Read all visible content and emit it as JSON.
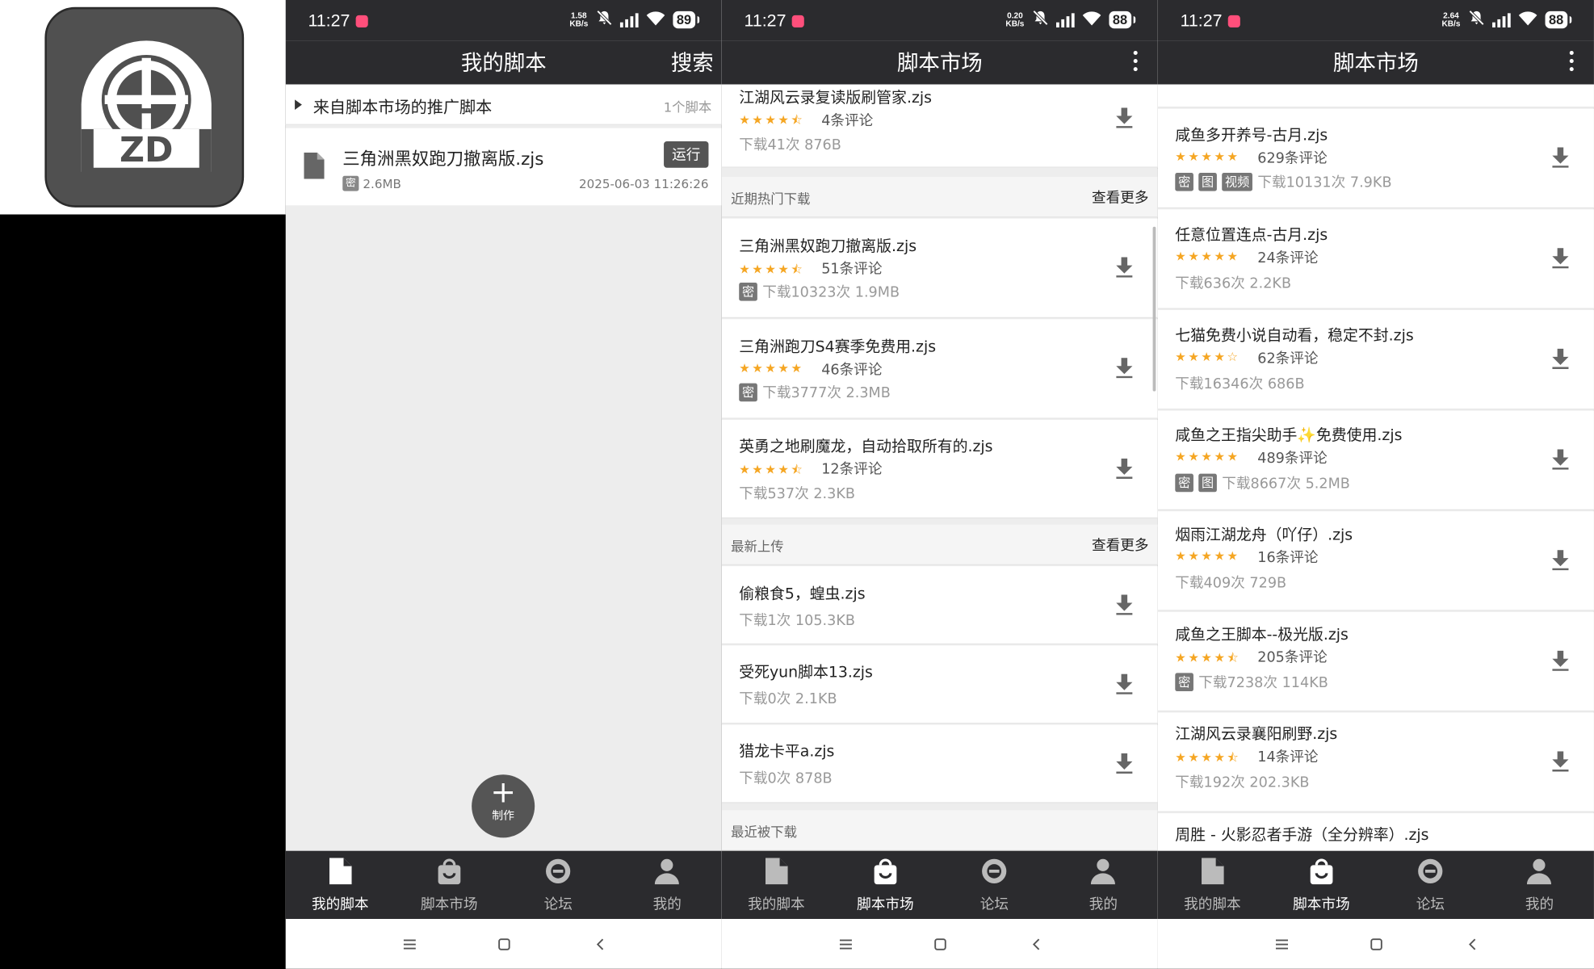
{
  "status": [
    {
      "time": "11:27",
      "net_value": "1.58",
      "net_unit": "KB/s",
      "battery": "89"
    },
    {
      "time": "11:27",
      "net_value": "0.20",
      "net_unit": "KB/s",
      "battery": "88"
    },
    {
      "time": "11:27",
      "net_value": "2.64",
      "net_unit": "KB/s",
      "battery": "88"
    }
  ],
  "app_icon": {
    "text": "ZD"
  },
  "screen1": {
    "title": "我的脚本",
    "search": "搜索",
    "promo": {
      "label": "来自脚本市场的推广脚本",
      "count": "1个脚本"
    },
    "script": {
      "name": "三角洲黑奴跑刀撤离版.zjs",
      "run": "运行",
      "tag": "密",
      "size": "2.6MB",
      "date": "2025-06-03 11:26:26"
    },
    "fab": {
      "label": "制作"
    }
  },
  "screen2": {
    "title": "脚本市场",
    "top_item": {
      "name": "江湖风云录复读版刷管家.zjs",
      "stars": "★★★★⯪",
      "reviews": "4条评论",
      "meta": "下载41次 876B"
    },
    "hot": {
      "title": "近期热门下载",
      "more": "查看更多",
      "items": [
        {
          "name": "三角洲黑奴跑刀撤离版.zjs",
          "stars": "★★★★⯪",
          "reviews": "51条评论",
          "tag": "密",
          "meta": "下载10323次 1.9MB"
        },
        {
          "name": "三角洲跑刀S4赛季免费用.zjs",
          "stars": "★★★★★",
          "reviews": "46条评论",
          "tag": "密",
          "meta": "下载3777次 2.3MB"
        },
        {
          "name": "英勇之地刷魔龙，自动拾取所有的.zjs",
          "stars": "★★★★⯪",
          "reviews": "12条评论",
          "meta": "下载537次 2.3KB"
        }
      ]
    },
    "latest": {
      "title": "最新上传",
      "more": "查看更多",
      "items": [
        {
          "name": "偷粮食5，蝗虫.zjs",
          "meta": "下载1次 105.3KB"
        },
        {
          "name": "受死yun脚本13.zjs",
          "meta": "下载0次 2.1KB"
        },
        {
          "name": "猎龙卡平a.zjs",
          "meta": "下载0次 878B"
        }
      ]
    },
    "recent": {
      "title": "最近被下载"
    }
  },
  "screen3": {
    "title": "脚本市场",
    "items": [
      {
        "name": "咸鱼多开养号-古月.zjs",
        "stars": "★★★★★",
        "reviews": "629条评论",
        "tags": [
          "密",
          "图",
          "视频"
        ],
        "meta": "下载10131次 7.9KB"
      },
      {
        "name": "任意位置连点-古月.zjs",
        "stars": "★★★★★",
        "reviews": "24条评论",
        "meta": "下载636次 2.2KB"
      },
      {
        "name": "七猫免费小说自动看，稳定不封.zjs",
        "stars": "★★★★☆",
        "reviews": "62条评论",
        "meta": "下载16346次 686B"
      },
      {
        "name": "咸鱼之王指尖助手✨免费使用.zjs",
        "stars": "★★★★★",
        "reviews": "489条评论",
        "tags": [
          "密",
          "图"
        ],
        "meta": "下载8667次 5.2MB"
      },
      {
        "name": "烟雨江湖龙舟（吖仔）.zjs",
        "stars": "★★★★★",
        "reviews": "16条评论",
        "meta": "下载409次 729B"
      },
      {
        "name": "咸鱼之王脚本--极光版.zjs",
        "stars": "★★★★⯪",
        "reviews": "205条评论",
        "tags": [
          "密"
        ],
        "meta": "下载7238次 114KB"
      },
      {
        "name": "江湖风云录襄阳刷野.zjs",
        "stars": "★★★★⯪",
        "reviews": "14条评论",
        "meta": "下载192次 202.3KB"
      },
      {
        "name": "周胜 - 火影忍者手游（全分辨率）.zjs"
      }
    ]
  },
  "nav": {
    "tabs": [
      "我的脚本",
      "脚本市场",
      "论坛",
      "我的"
    ]
  }
}
